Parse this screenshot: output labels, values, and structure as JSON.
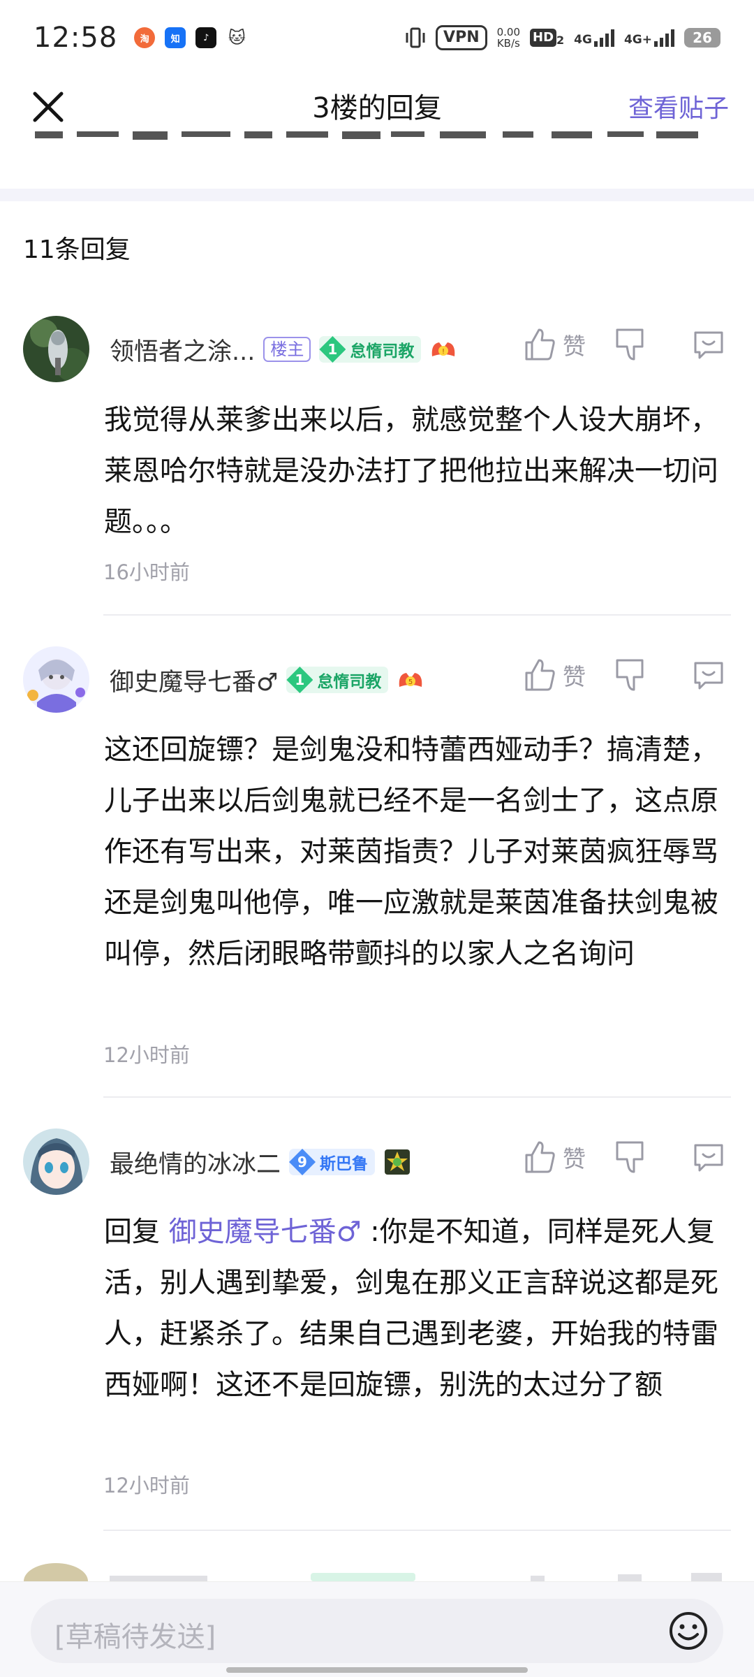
{
  "status_bar": {
    "time": "12:58",
    "vpn": "VPN",
    "net_speed_value": "0.00",
    "net_speed_unit": "KB/s",
    "hd": "HD",
    "hd_sub": "2",
    "net1": "4G",
    "net2": "4G+",
    "battery": "26"
  },
  "nav": {
    "title": "3楼的回复",
    "view_post": "查看贴子"
  },
  "reply_count": "11条回复",
  "replies": [
    {
      "username": "领悟者之涂...",
      "host_tag": "楼主",
      "level": "1",
      "level_name": "怠惰司教",
      "like_label": "赞",
      "content": "我觉得从莱爹出来以后，就感觉整个人设大崩坏，莱恩哈尔特就是没办法打了把他拉出来解决一切问题。。。",
      "time": "16小时前"
    },
    {
      "username": "御史魔导七番♂",
      "level": "1",
      "level_name": "怠惰司教",
      "like_label": "赞",
      "content": "这还回旋镖？是剑鬼没和特蕾西娅动手？搞清楚，儿子出来以后剑鬼就已经不是一名剑士了，这点原作还有写出来，对莱茵指责？儿子对莱茵疯狂辱骂还是剑鬼叫他停，唯一应激就是莱茵准备扶剑鬼被叫停，然后闭眼略带颤抖的以家人之名询问",
      "time": "12小时前"
    },
    {
      "username": "最绝情的冰冰二",
      "level": "9",
      "level_name": "斯巴鲁",
      "like_label": "赞",
      "reply_prefix": "回复 ",
      "reply_to": "御史魔导七番♂",
      "content": " :你是不知道，同样是死人复活，别人遇到挚爱，剑鬼在那义正言辞说这都是死人，赶紧杀了。结果自己遇到老婆，开始我的特雷西娅啊！这还不是回旋镖，别洗的太过分了额",
      "time": "12小时前"
    }
  ],
  "input": {
    "placeholder": "[草稿待发送]"
  },
  "colors": {
    "accent": "#6e63d6",
    "level_green": "#2cc77f",
    "level_blue": "#4a8cf7",
    "meta_gray": "#a1a1aa"
  }
}
